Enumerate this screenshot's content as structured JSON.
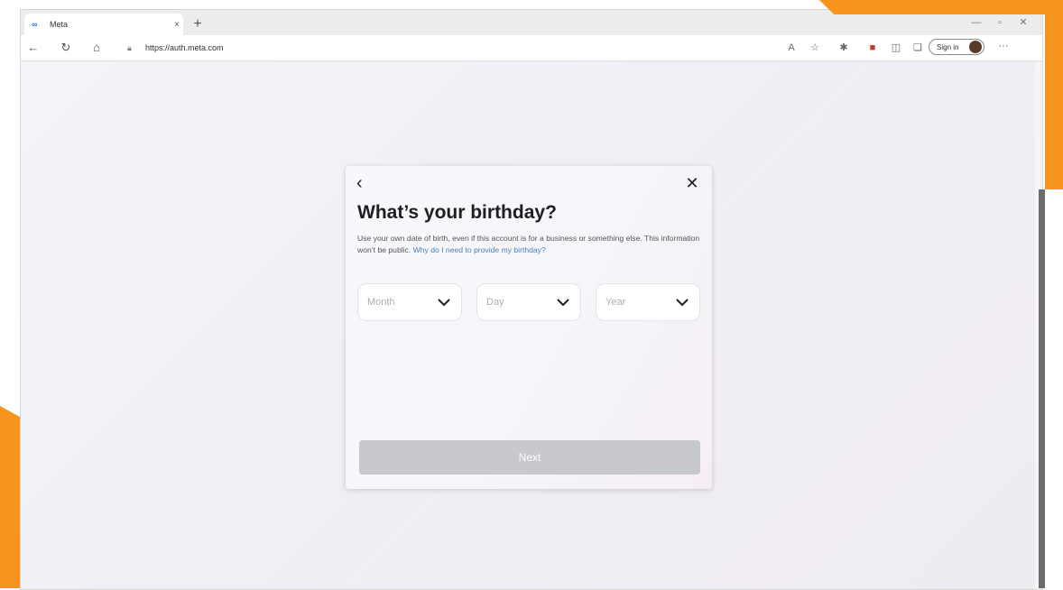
{
  "browser": {
    "tab_title": "Meta",
    "tab_close": "×",
    "new_tab": "+",
    "url": "https://auth.meta.com",
    "sign_in": "Sign in",
    "more": "···",
    "icons": [
      "back-icon",
      "refresh-icon",
      "home-icon",
      "lock-icon",
      "read-aloud-icon",
      "favorites-icon",
      "extensions-icon",
      "split-screen-icon",
      "collections-icon",
      "browser-essentials-icon",
      "profile-avatar-icon"
    ]
  },
  "modal": {
    "back": "‹",
    "close": "✕",
    "title": "What’s your birthday?",
    "description": "Use your own date of birth, even if this account is for a business or something else. This information won’t be public. ",
    "description_link": "Why do I need to provide my birthday?",
    "fields": {
      "month_placeholder": "Month",
      "day_placeholder": "Day",
      "year_placeholder": "Year"
    },
    "next_label": "Next"
  },
  "colors": {
    "accent_orange": "#f7941d",
    "link_blue": "#4b7fbd",
    "disabled_button": "#c7c9cd"
  }
}
